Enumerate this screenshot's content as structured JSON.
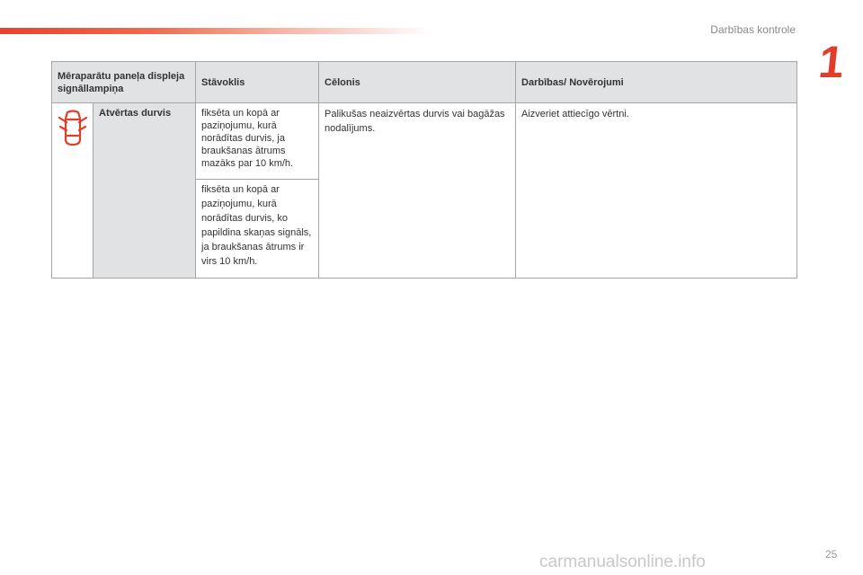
{
  "header": {
    "section_title": "Darbības kontrole",
    "chapter_number": "1",
    "accent_color": "#e23d28"
  },
  "table": {
    "columns": [
      "Mēraparātu paneļa displeja signāllampiņa",
      "Stāvoklis",
      "Cēlonis",
      "Darbības/ Novērojumi"
    ],
    "rows": [
      {
        "icon": "open-doors-car-icon",
        "name": "Atvērtas durvis",
        "states": [
          "fiksēta un kopā ar paziņojumu, kurā norādītas durvis, ja braukšanas ātrums mazāks par 10 km/h.",
          "fiksēta un kopā ar paziņojumu, kurā norādītas durvis, ko papildina skaņas signāls, ja braukšanas ātrums ir virs 10 km/h."
        ],
        "cause": "Palikušas neaizvērtas durvis vai bagāžas nodalījums.",
        "action": "Aizveriet attiecīgo vērtni."
      }
    ]
  },
  "footer": {
    "page_number": "25",
    "watermark": "carmanualsonline.info"
  }
}
